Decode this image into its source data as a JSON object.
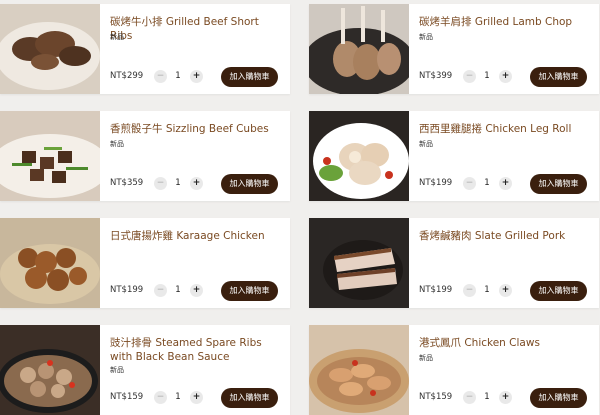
{
  "products": [
    {
      "name": "碳烤牛小排 Grilled Beef Short Ribs",
      "badge": "新品",
      "price": "NT$299",
      "qty": "1",
      "minus": "−",
      "plus": "+",
      "cart_label": "加入購物車"
    },
    {
      "name": "碳烤羊肩排 Grilled Lamb Chop",
      "badge": "新品",
      "price": "NT$399",
      "qty": "1",
      "minus": "−",
      "plus": "+",
      "cart_label": "加入購物車"
    },
    {
      "name": "香煎骰子牛 Sizzling Beef Cubes",
      "badge": "新品",
      "price": "NT$359",
      "qty": "1",
      "minus": "−",
      "plus": "+",
      "cart_label": "加入購物車"
    },
    {
      "name": "西西里雞腿捲 Chicken Leg Roll",
      "badge": "新品",
      "price": "NT$199",
      "qty": "1",
      "minus": "−",
      "plus": "+",
      "cart_label": "加入購物車"
    },
    {
      "name": "日式唐揚炸雞 Karaage Chicken",
      "badge": "",
      "price": "NT$199",
      "qty": "1",
      "minus": "−",
      "plus": "+",
      "cart_label": "加入購物車"
    },
    {
      "name": "香烤鹹豬肉 Slate Grilled Pork",
      "badge": "",
      "price": "NT$199",
      "qty": "1",
      "minus": "−",
      "plus": "+",
      "cart_label": "加入購物車"
    },
    {
      "name": "豉汁排骨 Steamed Spare Ribs with Black Bean Sauce",
      "badge": "新品",
      "price": "NT$159",
      "qty": "1",
      "minus": "−",
      "plus": "+",
      "cart_label": "加入購物車"
    },
    {
      "name": "港式鳳爪 Chicken Claws",
      "badge": "新品",
      "price": "NT$159",
      "qty": "1",
      "minus": "−",
      "plus": "+",
      "cart_label": "加入購物車"
    }
  ],
  "colors": {
    "accent_text": "#7a4a22",
    "button_bg": "#3a1f0e",
    "background": "#f0efed"
  }
}
